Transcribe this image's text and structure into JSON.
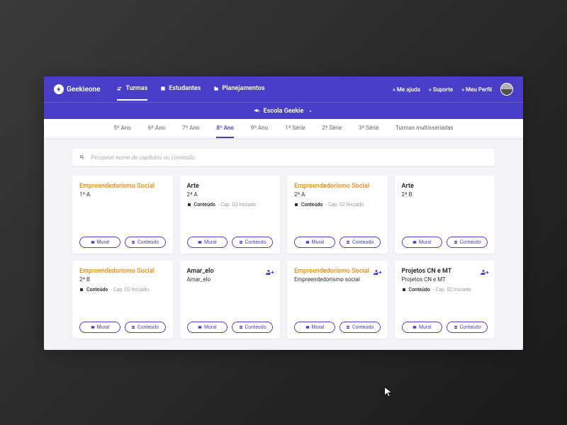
{
  "brand": "Geekieone",
  "nav": {
    "turmas": "Turmas",
    "estudantes": "Estudantes",
    "planejamentos": "Planejamentos"
  },
  "nav_right": {
    "help": "» Me ajuda",
    "support": "» Suporte",
    "profile": "» Meu Perfil"
  },
  "school": "Escola Geekie",
  "year_tabs": {
    "y5": "5º Ano",
    "y6": "6º Ano",
    "y7": "7º Ano",
    "y8": "8º Ano",
    "y9": "9º Ano",
    "s1": "1ª Série",
    "s2": "2ª Série",
    "s3": "3ª Série",
    "multi": "Turmas multisseriadas"
  },
  "search": {
    "placeholder": "Pesquise nome de capítulos ou conteúdo"
  },
  "buttons": {
    "mural": "Mural",
    "conteudo": "Conteúdo"
  },
  "labels": {
    "conteudo": "Conteúdo"
  },
  "cards": [
    {
      "title": "Empreendedorismo Social",
      "sub": "1ª A",
      "meta": "",
      "color": "orange"
    },
    {
      "title": "Arte",
      "sub": "2ª A",
      "meta": "Cap. 03 Iniciado",
      "color": "black"
    },
    {
      "title": "Empreendedorismo Social",
      "sub": "2ª A",
      "meta": "Cap. 02 Iniciado",
      "color": "orange"
    },
    {
      "title": "Arte",
      "sub": "2ª B",
      "meta": "",
      "color": "black"
    },
    {
      "title": "Empreendedorismo Social",
      "sub": "2ª B",
      "meta": "Cap. 02 Iniciado",
      "color": "orange"
    },
    {
      "title": "Amar_elo",
      "sub": "Amar_elo",
      "meta": "",
      "color": "black",
      "badge": true
    },
    {
      "title": "Empreendedorismo Social",
      "sub": "Empreendedorismo social",
      "meta": "",
      "color": "orange",
      "badge": true
    },
    {
      "title": "Projetos CN e MT",
      "sub": "Projetos CN e MT",
      "meta": "Cap. 02 Iniciado",
      "color": "black",
      "badge": true
    }
  ]
}
